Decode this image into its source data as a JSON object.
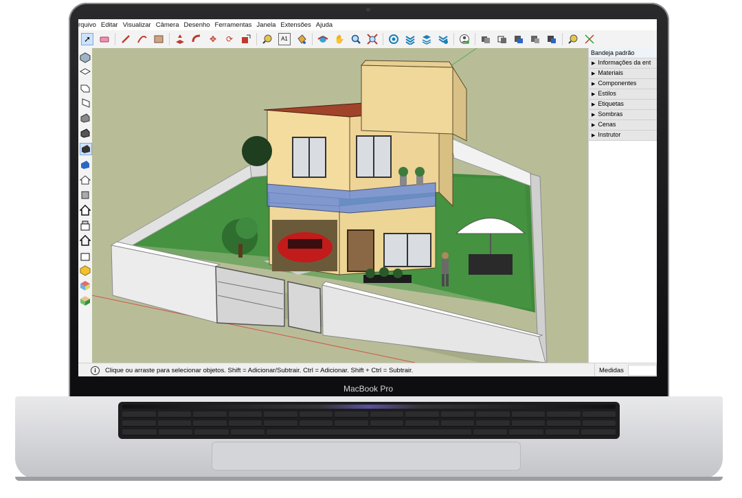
{
  "device": {
    "brand_label": "MacBook Pro"
  },
  "menu": [
    "rquivo",
    "Editar",
    "Visualizar",
    "Câmera",
    "Desenho",
    "Ferramentas",
    "Janela",
    "Extensões",
    "Ajuda"
  ],
  "tray": {
    "title": "Bandeja padrão",
    "items": [
      "Informações da ent",
      "Materiais",
      "Componentes",
      "Estilos",
      "Etiquetas",
      "Sombras",
      "Cenas",
      "Instrutor"
    ]
  },
  "status": {
    "hint": "Clique ou arraste para selecionar objetos. Shift = Adicionar/Subtrair. Ctrl = Adicionar. Shift + Ctrl = Subtrair.",
    "measures_label": "Medidas"
  },
  "toolbar_icons": [
    "select-icon",
    "eraser-icon",
    "pencil-icon",
    "arc-icon",
    "rectangle-icon",
    "push-pull-icon",
    "follow-me-icon",
    "move-icon",
    "rotate-icon",
    "scale-icon",
    "tape-measure-icon",
    "text-icon",
    "paint-bucket-icon",
    "orbit-icon",
    "pan-icon",
    "zoom-icon",
    "zoom-extents-icon",
    "warehouse-icon",
    "extension-warehouse-icon",
    "layout-icon",
    "send-to-layout-icon",
    "account-icon",
    "solid-union-icon",
    "solid-subtract-icon",
    "solid-intersect-icon",
    "solid-trim-icon",
    "solid-split-icon",
    "section-plane-icon",
    "axes-icon"
  ],
  "colors": {
    "viewport_bg": "#b8bd98",
    "accent": "#2a65c8"
  }
}
